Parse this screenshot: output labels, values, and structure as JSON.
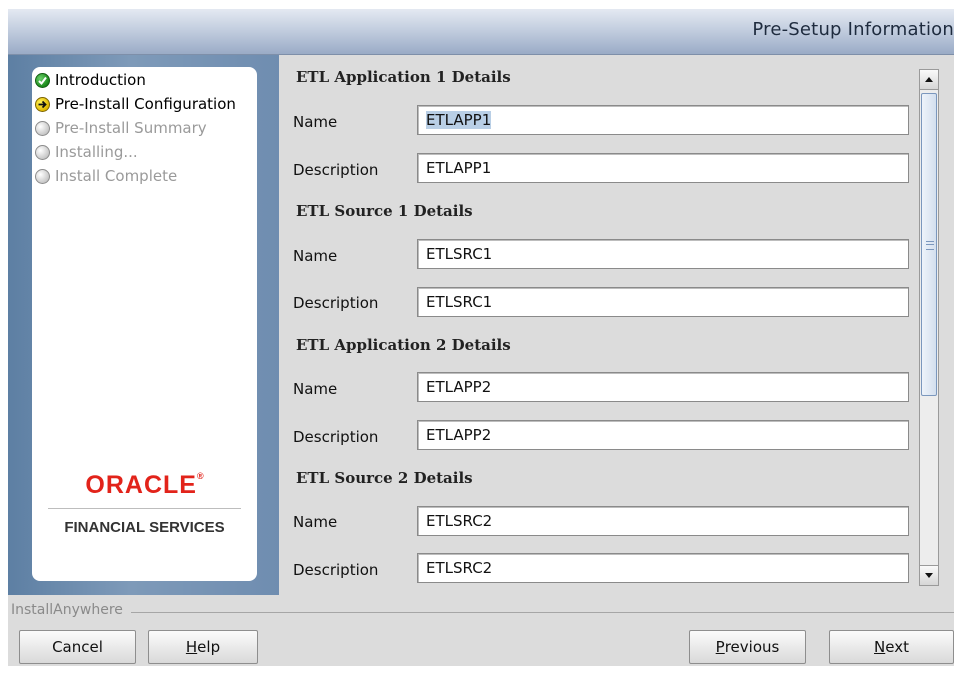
{
  "window": {
    "title": "Pre-Setup Information"
  },
  "steps": [
    {
      "label": "Introduction",
      "status": "done",
      "icon": "check-icon"
    },
    {
      "label": "Pre-Install Configuration",
      "status": "current",
      "icon": "arrow-right-icon"
    },
    {
      "label": "Pre-Install Summary",
      "status": "pending",
      "icon": "circle-icon"
    },
    {
      "label": "Installing...",
      "status": "pending",
      "icon": "circle-icon"
    },
    {
      "label": "Install Complete",
      "status": "pending",
      "icon": "circle-icon"
    }
  ],
  "branding": {
    "oracle": "ORACLE",
    "financial_services": "FINANCIAL SERVICES",
    "color": "#e2231a"
  },
  "form": {
    "sections": [
      {
        "heading": "ETL Application 1 Details",
        "name_label": "Name",
        "name_value": "ETLAPP1",
        "desc_label": "Description",
        "desc_value": "ETLAPP1"
      },
      {
        "heading": "ETL Source 1 Details",
        "name_label": "Name",
        "name_value": "ETLSRC1",
        "desc_label": "Description",
        "desc_value": "ETLSRC1"
      },
      {
        "heading": "ETL Application 2  Details",
        "name_label": "Name",
        "name_value": "ETLAPP2",
        "desc_label": "Description",
        "desc_value": "ETLAPP2"
      },
      {
        "heading": "ETL Source 2 Details",
        "name_label": "Name",
        "name_value": "ETLSRC2",
        "desc_label": "Description",
        "desc_value": "ETLSRC2"
      }
    ]
  },
  "footer": {
    "product": "InstallAnywhere",
    "cancel": "Cancel",
    "help": {
      "mnemonic": "H",
      "rest": "elp"
    },
    "previous": {
      "mnemonic": "P",
      "rest": "revious"
    },
    "next": {
      "mnemonic": "N",
      "rest": "ext"
    }
  }
}
